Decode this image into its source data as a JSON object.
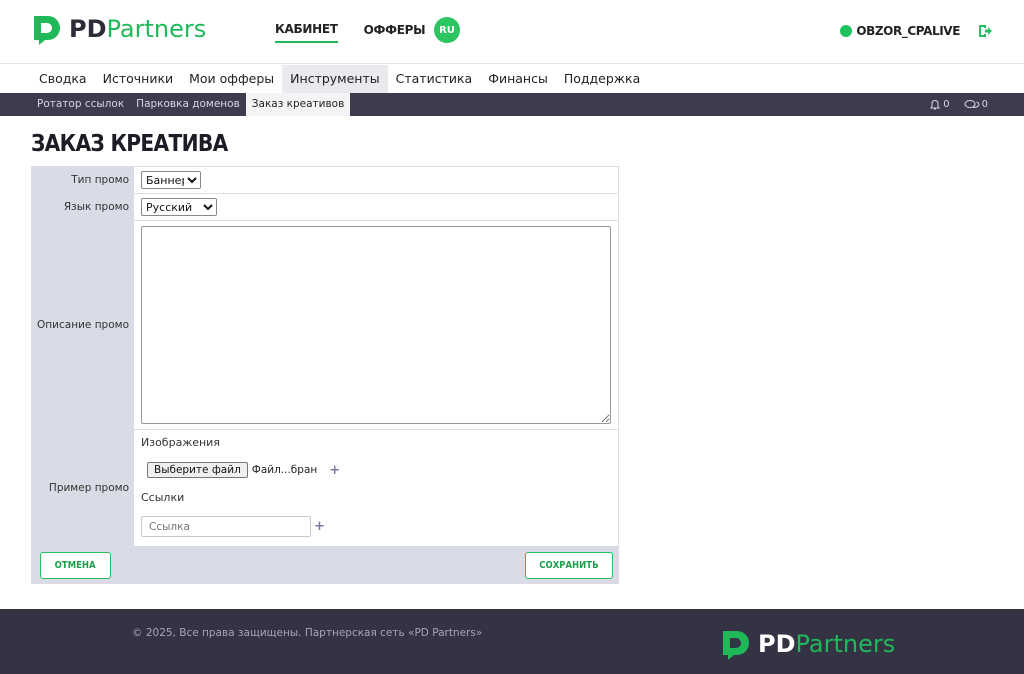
{
  "brand": {
    "logo_pd": "PD",
    "logo_partners": "Partners",
    "green": "#1fb95a",
    "dark": "#333344"
  },
  "topnav": {
    "items": [
      "КАБИНЕТ",
      "ОФФЕРЫ"
    ],
    "active_index": 0,
    "lang": "RU"
  },
  "user": {
    "name": "OBZOR_CPALIVE",
    "status_color": "#1fc25c",
    "logout_icon": "logout-icon"
  },
  "mainnav": {
    "items": [
      "Сводка",
      "Источники",
      "Мои офферы",
      "Инструменты",
      "Статистика",
      "Финансы",
      "Поддержка"
    ],
    "active_index": 3
  },
  "subnav": {
    "items": [
      "Ротатор ссылок",
      "Парковка доменов",
      "Заказ креативов"
    ],
    "active_index": 2,
    "notifications": "0",
    "messages": "0"
  },
  "page": {
    "title": "ЗАКАЗ КРЕАТИВА"
  },
  "form": {
    "type_label": "Тип промо",
    "type_value": "Баннер",
    "lang_label": "Язык промо",
    "lang_value": "Русский",
    "desc_label": "Описание промо",
    "example_label": "Пример промо",
    "images_label": "Изображения",
    "file_button": "Выберите файл",
    "file_status": "Файл...бран",
    "links_label": "Ссылки",
    "link_placeholder": "Ссылка",
    "cancel_label": "ОТМЕНА",
    "save_label": "СОХРАНИТЬ"
  },
  "footer": {
    "copyright": "© 2025, Все права защищены. Партнерская сеть «PD Partners»"
  }
}
